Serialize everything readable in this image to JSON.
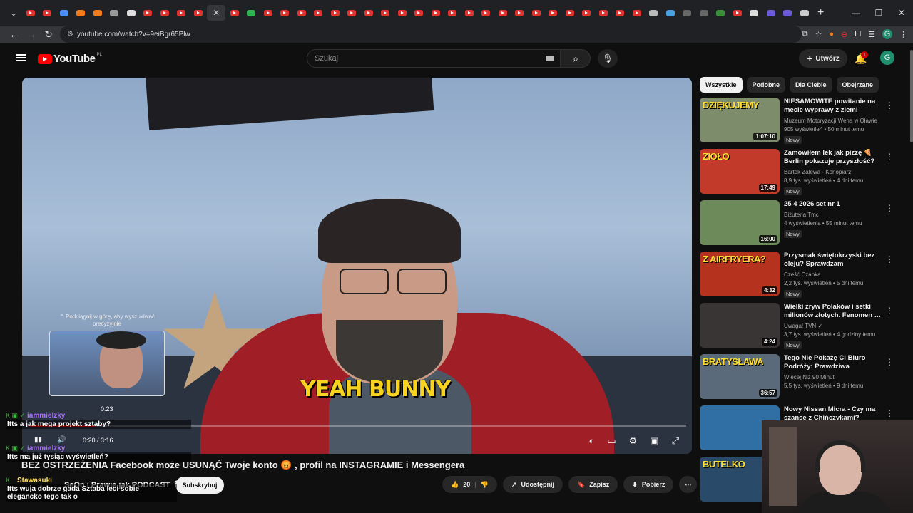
{
  "browser": {
    "tabs": [
      {
        "color": "#e03131",
        "type": "yt"
      },
      {
        "color": "#e03131",
        "type": "yt"
      },
      {
        "color": "#4d8ef7",
        "type": "doc"
      },
      {
        "color": "#f27b1a",
        "type": "blog"
      },
      {
        "color": "#f27b1a",
        "type": "blog"
      },
      {
        "color": "#999999",
        "type": "gh"
      },
      {
        "color": "#dddddd",
        "type": "x"
      },
      {
        "color": "#e03131",
        "type": "yt"
      },
      {
        "color": "#e03131",
        "type": "yt"
      },
      {
        "color": "#e03131",
        "type": "yt"
      },
      {
        "color": "#e03131",
        "type": "yt"
      },
      {
        "color": "#35363a",
        "type": "active"
      },
      {
        "color": "#e03131",
        "type": "yt"
      },
      {
        "color": "#2fb24f",
        "type": "sp"
      },
      {
        "color": "#e03131",
        "type": "yt"
      },
      {
        "color": "#e03131",
        "type": "yt"
      },
      {
        "color": "#e03131",
        "type": "yt"
      },
      {
        "color": "#e03131",
        "type": "yt"
      },
      {
        "color": "#e03131",
        "type": "yt"
      },
      {
        "color": "#e03131",
        "type": "yt"
      },
      {
        "color": "#e03131",
        "type": "yt"
      },
      {
        "color": "#e03131",
        "type": "yt"
      },
      {
        "color": "#e03131",
        "type": "yt"
      },
      {
        "color": "#e03131",
        "type": "yt"
      },
      {
        "color": "#e03131",
        "type": "yt"
      },
      {
        "color": "#e03131",
        "type": "yt"
      },
      {
        "color": "#e03131",
        "type": "yt"
      },
      {
        "color": "#e03131",
        "type": "yt"
      },
      {
        "color": "#e03131",
        "type": "yt"
      },
      {
        "color": "#e03131",
        "type": "yt"
      },
      {
        "color": "#e03131",
        "type": "yt"
      },
      {
        "color": "#e03131",
        "type": "yt"
      },
      {
        "color": "#e03131",
        "type": "yt"
      },
      {
        "color": "#e03131",
        "type": "yt"
      },
      {
        "color": "#e03131",
        "type": "yt"
      },
      {
        "color": "#e03131",
        "type": "yt"
      },
      {
        "color": "#e03131",
        "type": "yt"
      },
      {
        "color": "#bbbbbb",
        "type": "doc"
      },
      {
        "color": "#4aa0e0",
        "type": "st"
      },
      {
        "color": "#666666",
        "type": "doc"
      },
      {
        "color": "#666666",
        "type": "doc"
      },
      {
        "color": "#3a8f3a",
        "type": "leaf"
      },
      {
        "color": "#e03131",
        "type": "yt"
      },
      {
        "color": "#dddddd",
        "type": "x"
      },
      {
        "color": "#6b5bd6",
        "type": "ai"
      },
      {
        "color": "#6b5bd6",
        "type": "ai"
      },
      {
        "color": "#cccccc",
        "type": "chrome"
      }
    ],
    "active_tab_close": "✕",
    "new_tab": "+",
    "win_min": "—",
    "win_restore": "❐",
    "win_close": "✕",
    "url": "youtube.com/watch?v=9eiBgr65Plw"
  },
  "header": {
    "logo": "YouTube",
    "region": "PL",
    "search_placeholder": "Szukaj",
    "create_label": "Utwórz",
    "notif_count": "1",
    "avatar_letter": "G"
  },
  "player": {
    "caption": "YEAH BUNNY",
    "scrub_tip": "⌃ Podciągnij w górę, aby wyszukiwać precyzyjnie",
    "hover_time": "0:23",
    "time_display": "0:20 / 3:16",
    "progress": 0.1
  },
  "video": {
    "title": "BEZ OSTRZEŻENIA Facebook może USUNĄĆ Twoje konto 😡 , profil na INSTAGRAMIE i Messengera",
    "channel": "SeOn i Prawie jak PODCAST 🎙",
    "subscribe": "Subskrybuj",
    "likes": "20",
    "share": "Udostępnij",
    "save": "Zapisz",
    "download": "Pobierz"
  },
  "chat": [
    {
      "user": "iammielzky",
      "msg": "Itts a jak mega projekt sztaby?",
      "icons": "K ▣ ✓"
    },
    {
      "user": "iammielzky",
      "msg": "Itts ma już tysiąc wyświetleń?",
      "icons": "K ▣ ✓"
    },
    {
      "user": "Stawasuki",
      "msg": "Itts wuja dobrze gada Sztaba leci sobie elegancko tego tak o",
      "icons": "K"
    }
  ],
  "chips": [
    "Wszystkie",
    "Podobne",
    "Dla Ciebie",
    "Obejrzane"
  ],
  "recommendations": [
    {
      "title": "NIESAMOWITE powitanie na mecie wyprawy z ziemi tajskie…",
      "channel": "Muzeum Motoryzacji Wena w Oławie",
      "meta": "905 wyświetleń • 50 minut temu",
      "badge": "Nowy",
      "duration": "1:07:10",
      "thumb_text": "DZIĘKUJEMY",
      "bg": "#7d8c6a"
    },
    {
      "title": "Zamówiłem lek jak pizzę 🍕 Berlin pokazuje przyszłość?",
      "channel": "Bartek Zalewa - Konopiarz",
      "meta": "8,9 tys. wyświetleń • 4 dni temu",
      "badge": "Nowy",
      "duration": "17:49",
      "thumb_text": "ZIOŁO",
      "bg": "#c23a2a"
    },
    {
      "title": "25 4 2026 set nr 1",
      "channel": "Biżuteria Tmc",
      "meta": "4 wyświetlenia • 55 minut temu",
      "badge": "Nowy",
      "duration": "16:00",
      "thumb_text": "",
      "bg": "#6d8a5a"
    },
    {
      "title": "Przysmak świętokrzyski bez oleju? Sprawdzam",
      "channel": "Cześć Czapka",
      "meta": "2,2 tys. wyświetleń • 5 dni temu",
      "badge": "Nowy",
      "duration": "4:32",
      "thumb_text": "Z AIRFRYERA?",
      "bg": "#b5321f"
    },
    {
      "title": "Wielki zryw Polaków i setki milionów złotych. Fenomen …",
      "channel": "Uwaga! TVN ✓",
      "meta": "3,7 tys. wyświetleń • 4 godziny temu",
      "badge": "Nowy",
      "duration": "4:24",
      "thumb_text": "",
      "bg": "#3a3535"
    },
    {
      "title": "Tego Nie Pokażę Ci Biuro Podróży: Prawdziwa Bratysława",
      "channel": "Więcej Niż 90 Minut",
      "meta": "5,5 tys. wyświetleń • 9 dni temu",
      "badge": "",
      "duration": "36:57",
      "thumb_text": "BRATYSŁAWA",
      "bg": "#5a6a7a"
    },
    {
      "title": "Nowy Nissan Micra - Czy ma szansę z Chińczykami?",
      "channel": "",
      "meta": "",
      "badge": "",
      "duration": "",
      "thumb_text": "",
      "bg": "#2f6fa3"
    },
    {
      "title": "",
      "channel": "",
      "meta": "",
      "badge": "",
      "duration": "",
      "thumb_text": "BUTELKO",
      "bg": "#2a4a6a"
    }
  ]
}
